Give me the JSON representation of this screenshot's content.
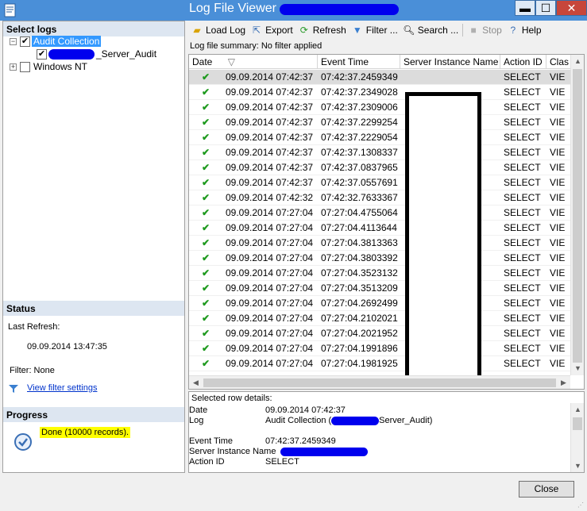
{
  "window": {
    "title": "Log File Viewer -",
    "controls": {
      "minimize": "▬",
      "maximize": "☐",
      "close": "✕"
    }
  },
  "left": {
    "select_logs_header": "Select logs",
    "tree": {
      "audit_collection": "Audit Collection",
      "server_audit_suffix": "_Server_Audit",
      "windows_nt": "Windows NT"
    },
    "status_header": "Status",
    "last_refresh_label": "Last Refresh:",
    "last_refresh_value": "09.09.2014 13:47:35",
    "filter_label": "Filter: None",
    "view_filter_link": "View filter settings",
    "progress_header": "Progress",
    "progress_text": "Done (10000 records)."
  },
  "toolbar": {
    "load_log": "Load Log",
    "export": "Export",
    "refresh": "Refresh",
    "filter": "Filter ...",
    "search": "Search ...",
    "stop": "Stop",
    "help": "Help"
  },
  "summary": "Log file summary: No filter applied",
  "grid": {
    "columns": [
      "Date",
      "Event Time",
      "Server Instance Name",
      "Action ID",
      "Clas"
    ],
    "sort_indicator": "▽",
    "rows": [
      {
        "date": "09.09.2014 07:42:37",
        "event_time": "07:42:37.2459349",
        "action_id": "SELECT",
        "class": "VIE"
      },
      {
        "date": "09.09.2014 07:42:37",
        "event_time": "07:42:37.2349028",
        "action_id": "SELECT",
        "class": "VIE"
      },
      {
        "date": "09.09.2014 07:42:37",
        "event_time": "07:42:37.2309006",
        "action_id": "SELECT",
        "class": "VIE"
      },
      {
        "date": "09.09.2014 07:42:37",
        "event_time": "07:42:37.2299254",
        "action_id": "SELECT",
        "class": "VIE"
      },
      {
        "date": "09.09.2014 07:42:37",
        "event_time": "07:42:37.2229054",
        "action_id": "SELECT",
        "class": "VIE"
      },
      {
        "date": "09.09.2014 07:42:37",
        "event_time": "07:42:37.1308337",
        "action_id": "SELECT",
        "class": "VIE"
      },
      {
        "date": "09.09.2014 07:42:37",
        "event_time": "07:42:37.0837965",
        "action_id": "SELECT",
        "class": "VIE"
      },
      {
        "date": "09.09.2014 07:42:37",
        "event_time": "07:42:37.0557691",
        "action_id": "SELECT",
        "class": "VIE"
      },
      {
        "date": "09.09.2014 07:42:32",
        "event_time": "07:42:32.7633367",
        "action_id": "SELECT",
        "class": "VIE"
      },
      {
        "date": "09.09.2014 07:27:04",
        "event_time": "07:27:04.4755064",
        "action_id": "SELECT",
        "class": "VIE"
      },
      {
        "date": "09.09.2014 07:27:04",
        "event_time": "07:27:04.4113644",
        "action_id": "SELECT",
        "class": "VIE"
      },
      {
        "date": "09.09.2014 07:27:04",
        "event_time": "07:27:04.3813363",
        "action_id": "SELECT",
        "class": "VIE"
      },
      {
        "date": "09.09.2014 07:27:04",
        "event_time": "07:27:04.3803392",
        "action_id": "SELECT",
        "class": "VIE"
      },
      {
        "date": "09.09.2014 07:27:04",
        "event_time": "07:27:04.3523132",
        "action_id": "SELECT",
        "class": "VIE"
      },
      {
        "date": "09.09.2014 07:27:04",
        "event_time": "07:27:04.3513209",
        "action_id": "SELECT",
        "class": "VIE"
      },
      {
        "date": "09.09.2014 07:27:04",
        "event_time": "07:27:04.2692499",
        "action_id": "SELECT",
        "class": "VIE"
      },
      {
        "date": "09.09.2014 07:27:04",
        "event_time": "07:27:04.2102021",
        "action_id": "SELECT",
        "class": "VIE"
      },
      {
        "date": "09.09.2014 07:27:04",
        "event_time": "07:27:04.2021952",
        "action_id": "SELECT",
        "class": "VIE"
      },
      {
        "date": "09.09.2014 07:27:04",
        "event_time": "07:27:04.1991896",
        "action_id": "SELECT",
        "class": "VIE"
      },
      {
        "date": "09.09.2014 07:27:04",
        "event_time": "07:27:04.1981925",
        "action_id": "SELECT",
        "class": "VIE"
      }
    ]
  },
  "details": {
    "title": "Selected row details:",
    "date_label": "Date",
    "date_value": "09.09.2014 07:42:37",
    "log_label": "Log",
    "log_value_prefix": "Audit Collection (",
    "log_value_suffix": "Server_Audit)",
    "event_time_label": "Event Time",
    "event_time_value": "07:42:37.2459349",
    "server_instance_label": "Server Instance Name",
    "action_id_label": "Action ID",
    "action_id_value": "SELECT"
  },
  "footer": {
    "close_label": "Close"
  },
  "colors": {
    "titlebar": "#4a8fd8",
    "selection": "#3399ff",
    "redaction": "#0000ee",
    "highlight": "#ffff00",
    "success": "#1f9a1f"
  }
}
